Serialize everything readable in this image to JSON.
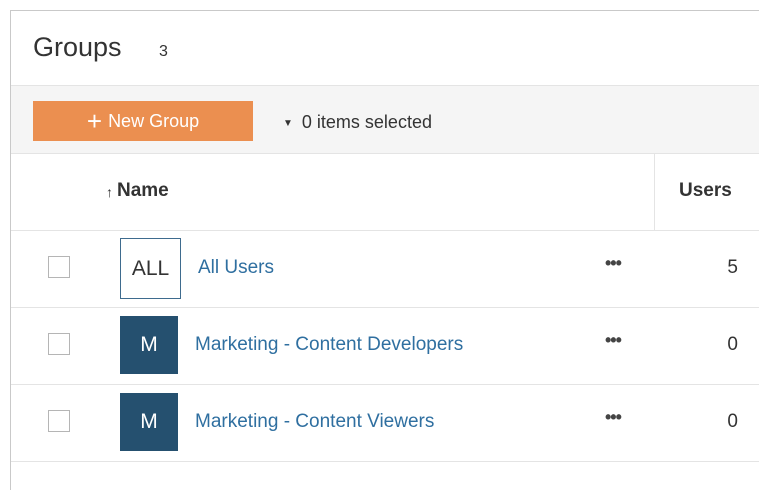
{
  "header": {
    "title": "Groups",
    "count": "3"
  },
  "toolbar": {
    "new_group_label": "New Group",
    "selection_label": "0 items selected"
  },
  "table": {
    "columns": {
      "name": "Name",
      "users": "Users"
    },
    "rows": [
      {
        "avatar": "ALL",
        "name": "All Users",
        "users": "5"
      },
      {
        "avatar": "M",
        "name": "Marketing - Content Developers",
        "users": "0"
      },
      {
        "avatar": "M",
        "name": "Marketing - Content Viewers",
        "users": "0"
      }
    ]
  },
  "icons": {
    "plus": "plus-icon",
    "caret": "caret-down-icon",
    "sort": "sort-ascending-icon",
    "more": "more-actions-icon"
  },
  "colors": {
    "accent_button": "#eb8f50",
    "avatar_fill": "#25506f",
    "link": "#2f6fa0"
  }
}
